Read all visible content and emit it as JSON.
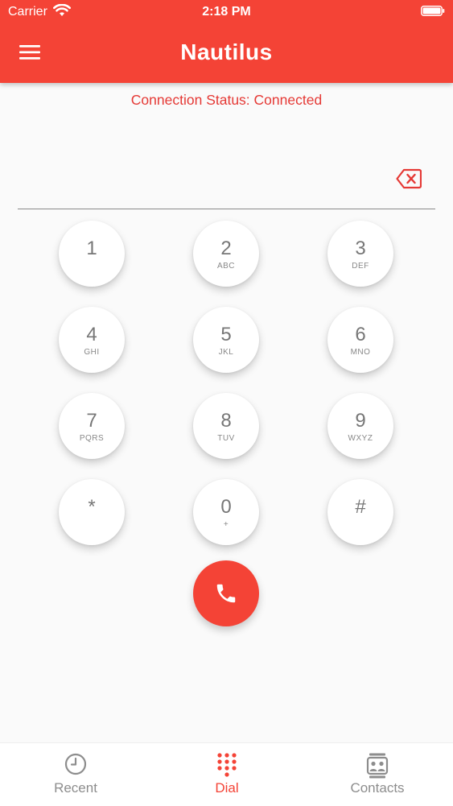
{
  "status_bar": {
    "carrier": "Carrier",
    "time": "2:18 PM"
  },
  "header": {
    "title": "Nautilus"
  },
  "connection": {
    "status_text": "Connection Status: Connected"
  },
  "keypad": {
    "keys": [
      {
        "digit": "1",
        "letters": ""
      },
      {
        "digit": "2",
        "letters": "ABC"
      },
      {
        "digit": "3",
        "letters": "DEF"
      },
      {
        "digit": "4",
        "letters": "GHI"
      },
      {
        "digit": "5",
        "letters": "JKL"
      },
      {
        "digit": "6",
        "letters": "MNO"
      },
      {
        "digit": "7",
        "letters": "PQRS"
      },
      {
        "digit": "8",
        "letters": "TUV"
      },
      {
        "digit": "9",
        "letters": "WXYZ"
      },
      {
        "digit": "*",
        "letters": ""
      },
      {
        "digit": "0",
        "letters": "+"
      },
      {
        "digit": "#",
        "letters": ""
      }
    ]
  },
  "tabs": [
    {
      "label": "Recent",
      "icon": "clock-icon",
      "active": false
    },
    {
      "label": "Dial",
      "icon": "dialpad-icon",
      "active": true
    },
    {
      "label": "Contacts",
      "icon": "contacts-icon",
      "active": false
    }
  ],
  "colors": {
    "accent": "#f44336",
    "background": "#fafafa",
    "inactive": "#8d8d8d"
  }
}
